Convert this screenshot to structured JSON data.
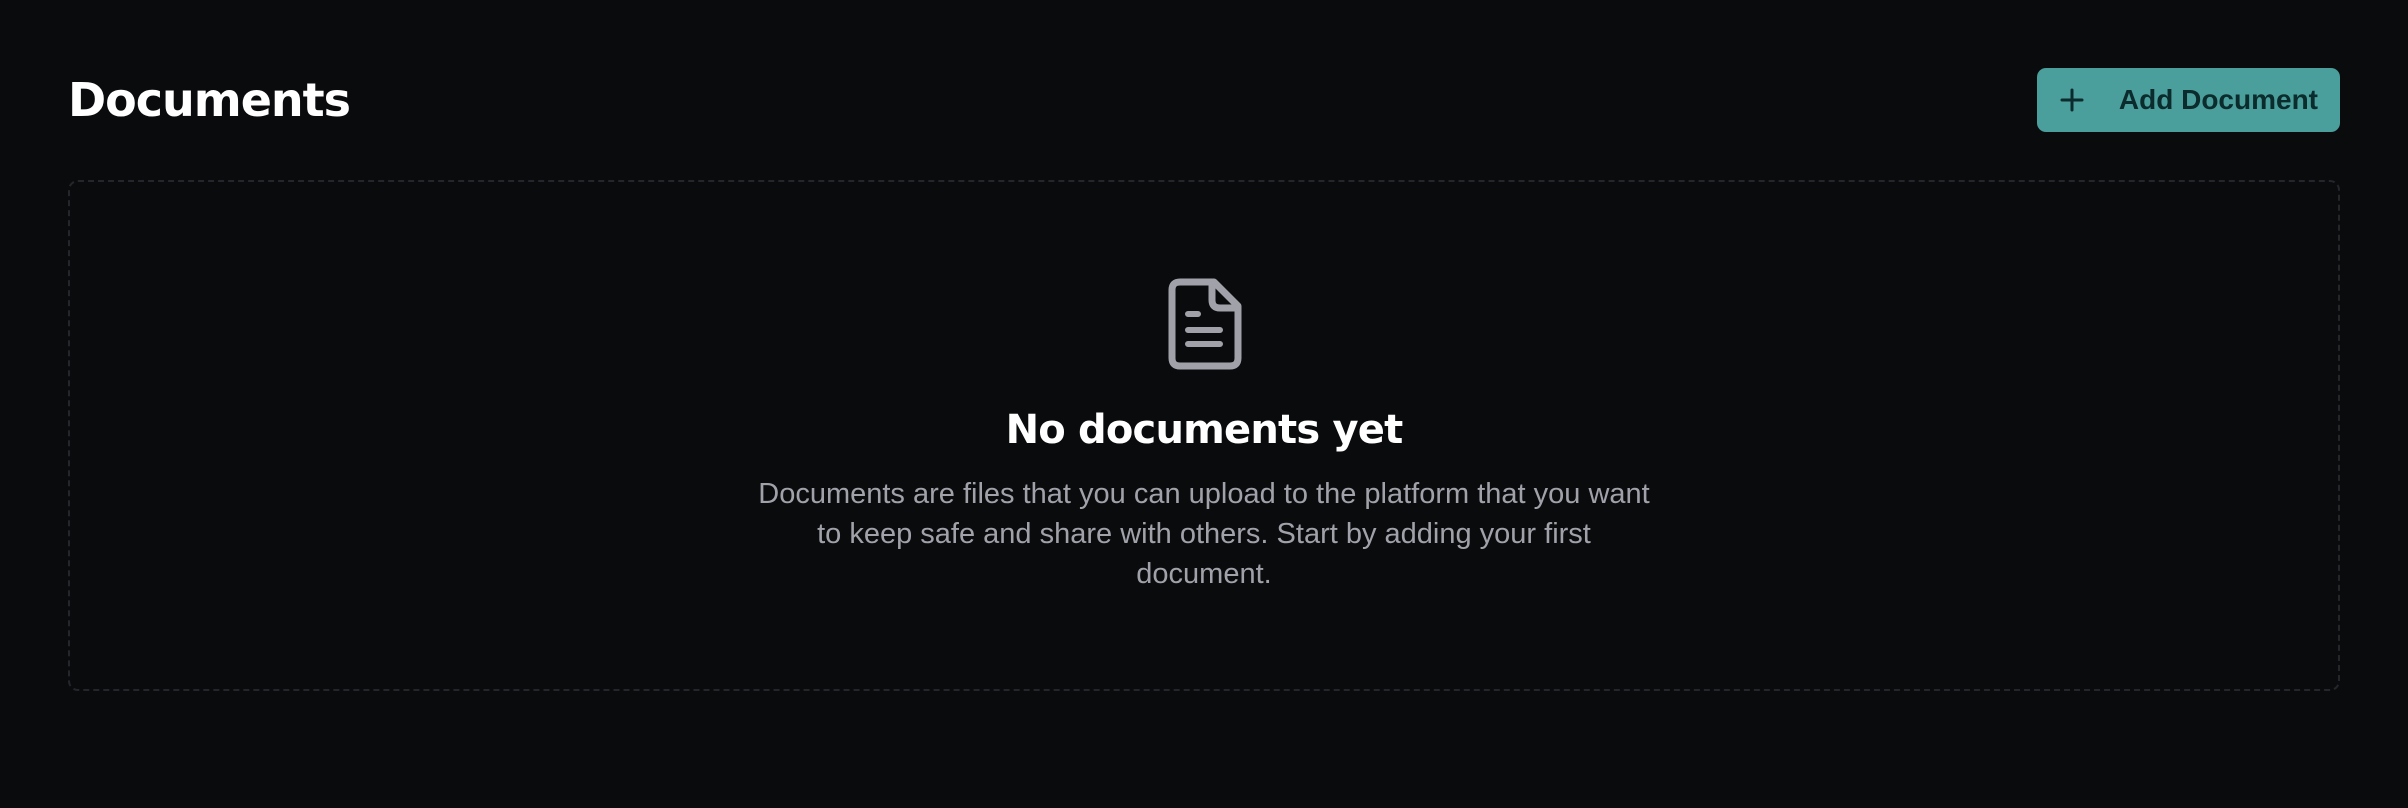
{
  "header": {
    "title": "Documents",
    "add_button_label": "Add Document",
    "add_button_icon": "plus-icon"
  },
  "empty_state": {
    "icon": "document-icon",
    "title": "No documents yet",
    "description": "Documents are files that you can upload to the platform that you want to keep safe and share with others. Start by adding your first document."
  },
  "colors": {
    "background": "#0a0b0d",
    "accent": "#4a9e9b",
    "accent_text": "#0b2b2d",
    "muted_text": "#a1a1aa",
    "panel_border": "#24262b"
  }
}
